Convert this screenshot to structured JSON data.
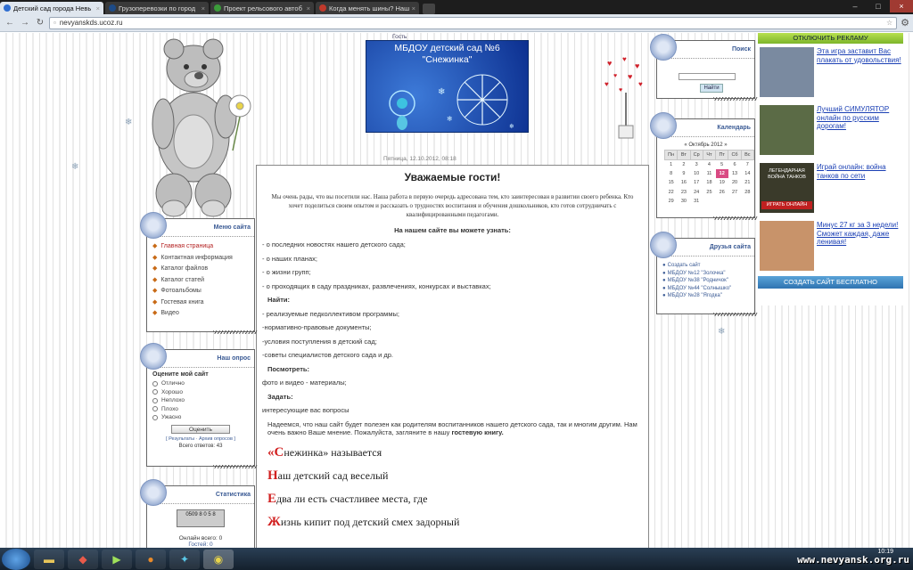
{
  "browser": {
    "tabs": [
      {
        "label": "Детский сад города Невь",
        "color": "#2f6ed1",
        "active": true
      },
      {
        "label": "Грузоперевозки по город",
        "color": "#1d4b88",
        "active": false
      },
      {
        "label": "Проект рельсового автоб",
        "color": "#3b9b3a",
        "active": false
      },
      {
        "label": "Когда менять шины? Наш",
        "color": "#c0392b",
        "active": false
      }
    ],
    "url": "nevyanskds.ucoz.ru"
  },
  "header": {
    "guest": "Гость",
    "banner_title": "МБДОУ детский сад №6",
    "banner_subtitle": "\"Снежинка\""
  },
  "post": {
    "date": "Пятница, 12.10.2012, 08:18",
    "title": "Уважаемые гости!",
    "intro": "Мы очень рады, что вы посетили нас. Наша работа в первую очередь адресована тем, кто заинтересован в развитии своего ребенка. Кто хочет поделиться своим опытом и рассказать о трудностях воспитания и обучения дошкольников, кто готов сотрудничать с квалифицированными педагогами.",
    "subtitle": "На нашем сайте вы можете узнать:",
    "lines": [
      {
        "text": "- о последних новостях нашего детского сада;",
        "bold": false
      },
      {
        "text": "- о наших планах;",
        "bold": false
      },
      {
        "text": "- о жизни групп;",
        "bold": false
      },
      {
        "text": "- о проходящих в саду праздниках, развлечениях, конкурсах и выставках;",
        "bold": false
      },
      {
        "text": "Найти:",
        "bold": true
      },
      {
        "text": "- реализуемые педколлективом программы;",
        "bold": false
      },
      {
        "text": "-нормативно-правовые документы;",
        "bold": false
      },
      {
        "text": "-условия поступления в детский сад;",
        "bold": false
      },
      {
        "text": "-советы специалистов детского сада и др.",
        "bold": false
      },
      {
        "text": "Посмотреть:",
        "bold": true
      },
      {
        "text": "фото и видео -  материалы;",
        "bold": false
      },
      {
        "text": "Задать:",
        "bold": true
      },
      {
        "text": "интересующие вас вопросы",
        "bold": false
      }
    ],
    "final_a": "Надеемся, что наш сайт будет полезен как родителям воспитанников нашего детского сада, так и многим другим. Нам очень важно Ваше мнение. Пожалуйста, загляните в нашу ",
    "final_b": "гостевую книгу.",
    "poem": [
      {
        "cap": "«С",
        "rest": "нежинка» называется"
      },
      {
        "cap": "Н",
        "rest": "аш детский сад веселый"
      },
      {
        "cap": "Е",
        "rest": "два ли есть счастливее места, где"
      },
      {
        "cap": "Ж",
        "rest": "изнь кипит под детский смех задорный"
      }
    ]
  },
  "menu": {
    "title": "Меню сайта",
    "items": [
      "Главная страница",
      "Контактная информация",
      "Каталог файлов",
      "Каталог статей",
      "Фотоальбомы",
      "Гостевая книга",
      "Видео"
    ]
  },
  "poll": {
    "title": "Наш опрос",
    "question": "Оцените мой сайт",
    "options": [
      "Отлично",
      "Хорошо",
      "Неплохо",
      "Плохо",
      "Ужасно"
    ],
    "vote": "Оценить",
    "results": "Результаты",
    "archive": "Архив опросов",
    "total": "Всего ответов: 43"
  },
  "stats": {
    "title": "Статистика",
    "counter_top": "0509  8 0 5 8",
    "online": "Онлайн всего: 0",
    "guests": "Гостей: 0"
  },
  "search": {
    "title": "Поиск",
    "button": "Найти"
  },
  "calendar": {
    "title": "Календарь",
    "month": "«  Октябрь 2012  »",
    "days": [
      "Пн",
      "Вт",
      "Ср",
      "Чт",
      "Пт",
      "Сб",
      "Вс"
    ],
    "weeks": [
      [
        "1",
        "2",
        "3",
        "4",
        "5",
        "6",
        "7"
      ],
      [
        "8",
        "9",
        "10",
        "11",
        "12",
        "13",
        "14"
      ],
      [
        "15",
        "16",
        "17",
        "18",
        "19",
        "20",
        "21"
      ],
      [
        "22",
        "23",
        "24",
        "25",
        "26",
        "27",
        "28"
      ],
      [
        "29",
        "30",
        "31",
        "",
        "",
        "",
        ""
      ]
    ],
    "today": "12"
  },
  "friends": {
    "title": "Друзья сайта",
    "items": [
      "Создать сайт",
      "МБДОУ №12 \"Золочка\"",
      "МБДОУ №38 \"Родничок\"",
      "МБДОУ №44 \"Солнышко\"",
      "МБДОУ №28 \"Ягодка\""
    ]
  },
  "ads": {
    "disable": "ОТКЛЮЧИТЬ РЕКЛАМУ",
    "items": [
      {
        "text": "Эта игра заставит Вас плакать от удовольствия!",
        "thumb": "#7a8aa0"
      },
      {
        "text": "Лучший СИМУЛЯТОР онлайн по русским дорогам!",
        "thumb": "#5b6b46"
      },
      {
        "text": "Играй онлайн: война танков по сети",
        "thumb": "#3a3a2a"
      },
      {
        "text": "Минус 27 кг за 3 недели! Сможет каждая, даже ленивая!",
        "thumb": "#c8936a"
      }
    ],
    "tank_banner": "ЛЕГЕНДАРНАЯ ВОЙНА ТАНКОВ",
    "tank_button": "ИГРАТЬ ОНЛАЙН",
    "create": "СОЗДАТЬ САЙТ БЕСПЛАТНО"
  },
  "taskbar": {
    "clock": "10:19",
    "site": "www.nevyansk.org.ru"
  }
}
